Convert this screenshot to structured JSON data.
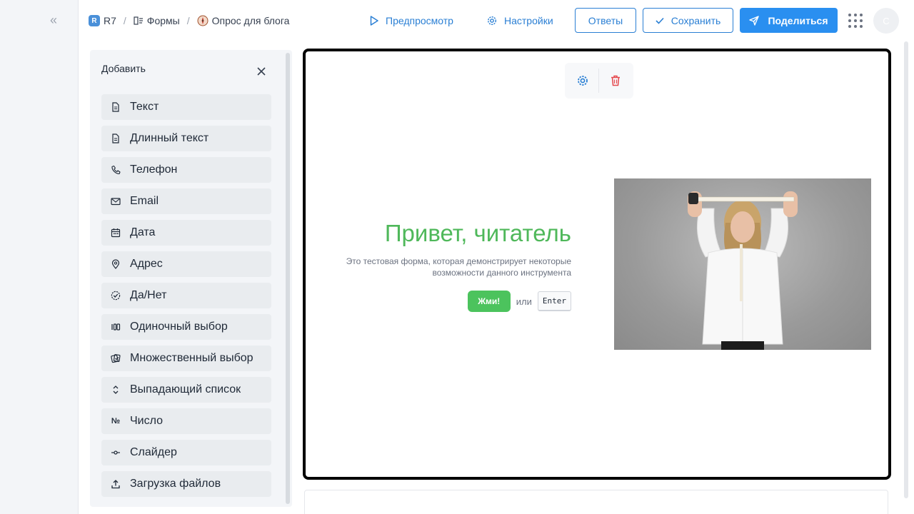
{
  "nav": {
    "collapse_icon": "«"
  },
  "breadcrumb": {
    "root_badge": "R",
    "root": "R7",
    "forms": "Формы",
    "current": "Опрос для блога"
  },
  "header": {
    "preview": "Предпросмотр",
    "settings": "Настройки",
    "answers": "Ответы",
    "save": "Сохранить",
    "share": "Поделиться",
    "avatar_initial": "С"
  },
  "add_panel": {
    "title": "Добавить",
    "items": [
      {
        "label": "Текст",
        "icon": "file-icon"
      },
      {
        "label": "Длинный текст",
        "icon": "file-icon"
      },
      {
        "label": "Телефон",
        "icon": "phone-icon"
      },
      {
        "label": "Email",
        "icon": "mail-icon"
      },
      {
        "label": "Дата",
        "icon": "calendar-icon"
      },
      {
        "label": "Адрес",
        "icon": "map-pin-icon"
      },
      {
        "label": "Да/Нет",
        "icon": "check-circle-icon"
      },
      {
        "label": "Одиночный выбор",
        "icon": "single-choice-icon"
      },
      {
        "label": "Множественный выбор",
        "icon": "multi-choice-icon"
      },
      {
        "label": "Выпадающий список",
        "icon": "dropdown-icon"
      },
      {
        "label": "Число",
        "icon": "number-icon",
        "glyph": "№"
      },
      {
        "label": "Слайдер",
        "icon": "slider-icon"
      },
      {
        "label": "Загрузка файлов",
        "icon": "upload-icon"
      }
    ]
  },
  "welcome": {
    "title": "Привет, читатель",
    "description": "Это тестовая форма, которая демонстрирует некоторые возможности данного инструмента",
    "button": "Жми!",
    "or": "или",
    "key": "Enter"
  },
  "colors": {
    "accent": "#2a8ff0",
    "title_green": "#4fb85a",
    "button_green": "#4cc35d",
    "danger": "#e5484d"
  }
}
